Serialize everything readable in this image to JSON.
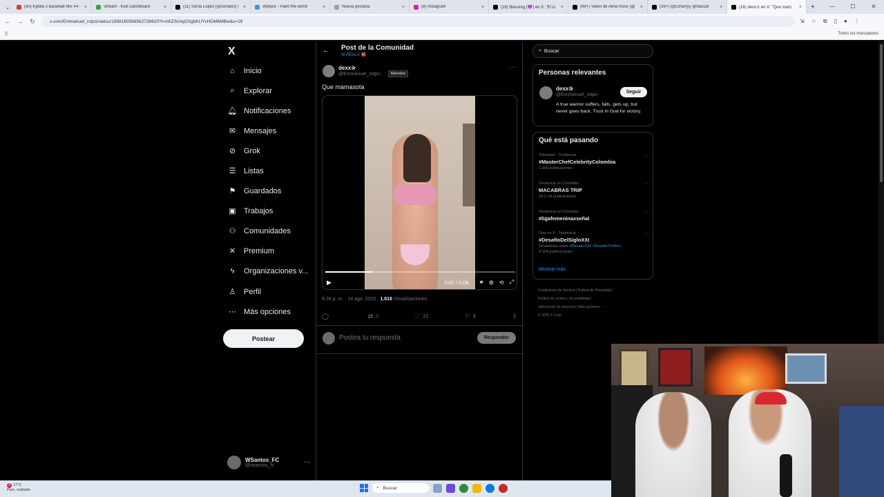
{
  "browser": {
    "tabs": [
      {
        "title": "(80) Kybba x Baseball Mix #4 - ",
        "color": "#e53935",
        "active": false
      },
      {
        "title": "Stream - Kick Dashboard",
        "color": "#43a047",
        "active": false
      },
      {
        "title": "(11) Sonia Lopez (@soniaici) / ",
        "color": "#000000",
        "active": false
      },
      {
        "title": "Wplace - Paint the world",
        "color": "#4a90d9",
        "active": false
      },
      {
        "title": "Nueva pestaña",
        "color": "#9e9e9e",
        "active": false
      },
      {
        "title": "(8) Instagram",
        "color": "#d6249f",
        "active": false
      },
      {
        "title": "(16) Blessing (💜) en X: \"El Li",
        "color": "#000000",
        "active": false
      },
      {
        "title": "(99+) Video de Alina Rose (@",
        "color": "#000000",
        "active": false
      },
      {
        "title": "(39+) @Echarryy @baucat",
        "color": "#000000",
        "active": false
      },
      {
        "title": "(16) dexx✰ en X: \"Que mam",
        "color": "#000000",
        "active": true
      }
    ],
    "tab_close": "×",
    "new_tab": "+",
    "url": "x.com/Emmanuel_rstpo/status/1956180586562736623?t=AKZSchqOXgbKUYvHGM6MBw&s=19",
    "bookmarks_all": "Todos los marcadores"
  },
  "sidebar": {
    "logo": "X",
    "items": [
      {
        "label": "Inicio",
        "icon": "⌂"
      },
      {
        "label": "Explorar",
        "icon": "⌕"
      },
      {
        "label": "Notificaciones",
        "icon": "🔔︎"
      },
      {
        "label": "Mensajes",
        "icon": "✉"
      },
      {
        "label": "Grok",
        "icon": "⊘"
      },
      {
        "label": "Listas",
        "icon": "☰"
      },
      {
        "label": "Guardados",
        "icon": "⚑"
      },
      {
        "label": "Trabajos",
        "icon": "▣"
      },
      {
        "label": "Comunidades",
        "icon": "⚇"
      },
      {
        "label": "Premium",
        "icon": "✕"
      },
      {
        "label": "Organizaciones v...",
        "icon": "ϟ"
      },
      {
        "label": "Perfil",
        "icon": "♙"
      },
      {
        "label": "Más opciones",
        "icon": "⋯"
      }
    ],
    "post_button": "Postear",
    "user": {
      "name": "WSantos_FC",
      "handle": "@wsantos_fc",
      "more": "···"
    }
  },
  "main": {
    "back": "←",
    "title": "Post de la Comunidad",
    "subtitle": "W REALS 👹",
    "tweet": {
      "name": "dexx✰",
      "handle": "@Emmanuel_rstpo ·",
      "badge": "Miembro",
      "more": "···",
      "text": "Que mamasota",
      "video": {
        "time": "0:02 / 0:08",
        "progress": 0.25,
        "play": "▶"
      },
      "timestamp": "9:26 p. m. · 14 ago. 2025 ·",
      "views_count": "1.816",
      "views_label": "Visualizaciones",
      "actions": {
        "reply": "",
        "retweets": "2",
        "likes": "22",
        "bookmarks": "8"
      }
    },
    "reply_placeholder": "Postea tu respuesta",
    "reply_button": "Responder"
  },
  "right": {
    "search_placeholder": "Buscar",
    "relevant": {
      "title": "Personas relevantes",
      "name": "dexx✰",
      "handle": "@Emmanuel_rstpo",
      "follow": "Seguir",
      "bio": "A true warrior suffers, falls, gets up, but never goes back. Trust in God for victory."
    },
    "trending": {
      "title": "Qué está pasando",
      "items": [
        {
          "context": "Televisión · Tendencia",
          "name": "#MasterChefCelebrityColombia",
          "count": "1.465 publicaciones"
        },
        {
          "context": "Tendencia en Colombia",
          "name": "MACABRAS TRIP",
          "count": "14,2 mil publicaciones"
        },
        {
          "context": "Tendencia en Colombia",
          "name": "#ligafemeninaxseñal",
          "count": ""
        },
        {
          "context": "Solo en X · Tendencia",
          "name": "#DesafíoDelSigloXXI",
          "tags_prefix": "Tendencias sobre",
          "tag1": "#DesafioXXI",
          "tag2": "#DesafioTheBox",
          "count": "9.124 publicaciones"
        }
      ],
      "show_more": "Mostrar más"
    },
    "footer": {
      "line1": "Condiciones de Servicio  |  Política de Privacidad  |",
      "line2": "Política de cookies  |  Accesibilidad  |",
      "line3": "Información de anuncios  |  Más opciones ···",
      "line4": "© 2025 X Corp."
    }
  },
  "taskbar": {
    "temp": "17°C",
    "weather": "Parc. nublado",
    "notif_count": "3",
    "search": "Buscar"
  }
}
